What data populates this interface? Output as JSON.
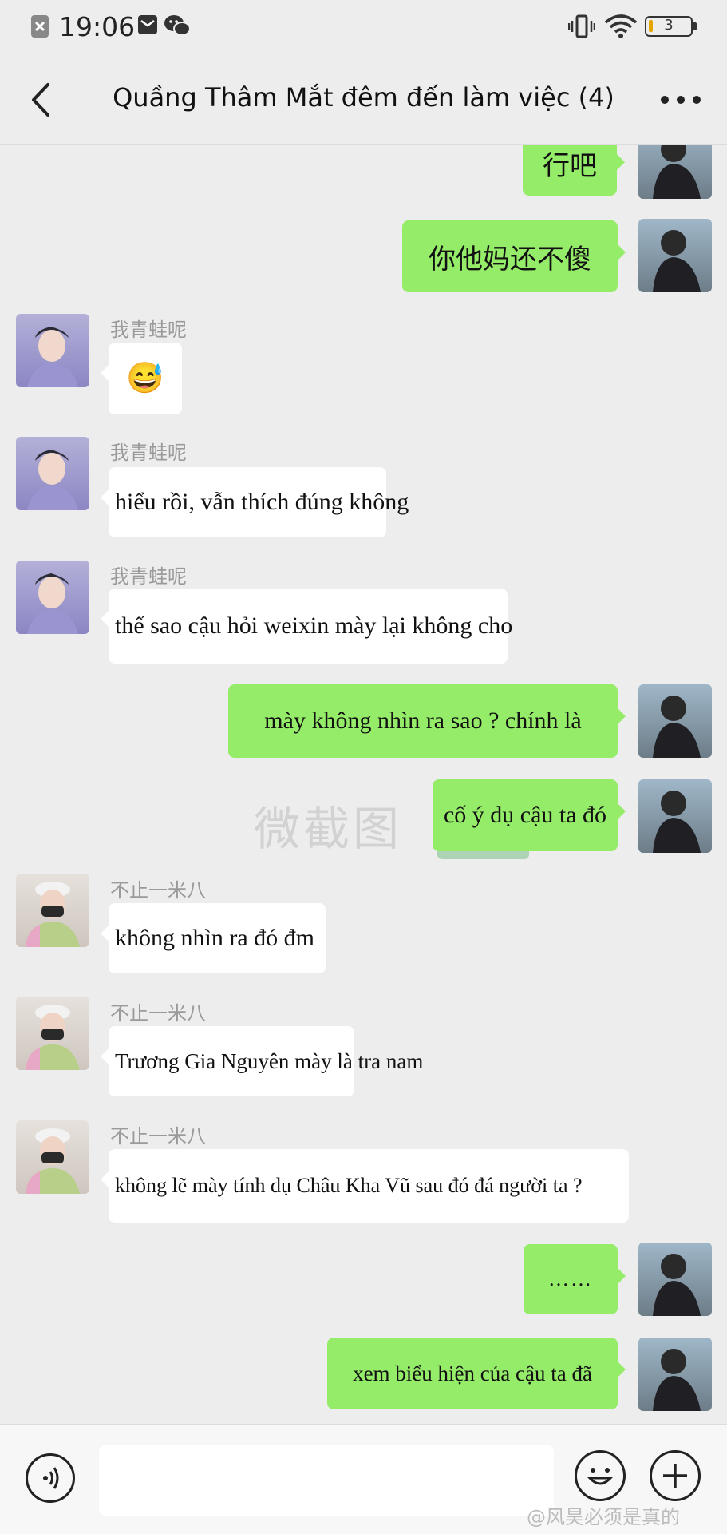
{
  "status_bar": {
    "time": "19:06",
    "battery": "3",
    "icons": [
      "close-box-icon",
      "mail-icon",
      "wechat-icon",
      "vibrate-icon",
      "wifi-icon",
      "battery-icon"
    ]
  },
  "header": {
    "title": "Quầng Thâm Mắt đêm đến làm việc (4)",
    "back_icon": "chevron-left-icon",
    "more_icon": "more-dots-icon"
  },
  "messages": [
    {
      "side": "right",
      "text": "行吧"
    },
    {
      "side": "right",
      "text": "你他妈还不傻"
    },
    {
      "side": "left",
      "sender": "我青蛙呢",
      "text": "😅"
    },
    {
      "side": "left",
      "sender": "我青蛙呢",
      "text": "hiểu rồi, vẫn thích đúng không"
    },
    {
      "side": "left",
      "sender": "我青蛙呢",
      "text": "thế sao cậu hỏi weixin mày lại không cho"
    },
    {
      "side": "right",
      "text": "mày không nhìn ra sao ? chính là"
    },
    {
      "side": "right",
      "text": "cố ý dụ cậu ta đó"
    },
    {
      "side": "left",
      "sender": "不止一米八",
      "text": "không nhìn ra đó đm"
    },
    {
      "side": "left",
      "sender": "不止一米八",
      "text": "Trương Gia Nguyên mày là tra nam"
    },
    {
      "side": "left",
      "sender": "不止一米八",
      "text": "không lẽ mày tính dụ Châu Kha Vũ sau đó đá người ta ?"
    },
    {
      "side": "right",
      "text": "……"
    },
    {
      "side": "right",
      "text": "xem biểu hiện của cậu ta đã"
    }
  ],
  "watermark": "微截图",
  "input_bar": {
    "placeholder": "",
    "icons": [
      "voice-icon",
      "emoji-icon",
      "plus-icon"
    ]
  },
  "footer_watermark": "@风昊必须是真的",
  "colors": {
    "background": "#ededed",
    "green_bubble": "#95ec69",
    "white_bubble": "#ffffff",
    "sender_gray": "#9a9a9a"
  }
}
